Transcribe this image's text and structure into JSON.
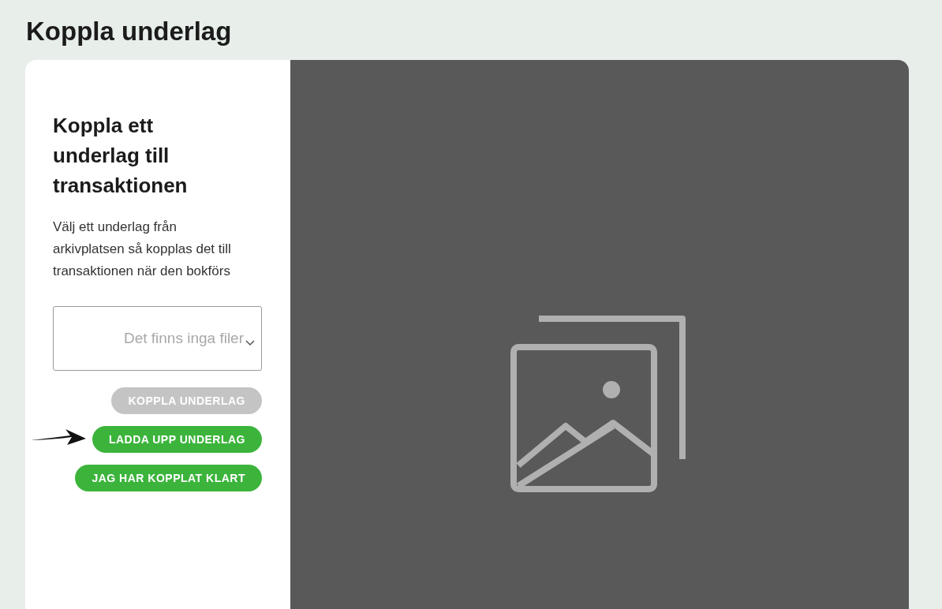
{
  "page": {
    "title": "Koppla underlag"
  },
  "panel": {
    "heading": "Koppla ett underlag till transaktionen",
    "description": "Välj ett underlag från arkivplatsen så kopplas det till transaktionen när den bokförs",
    "file_select": {
      "placeholder": "Det finns inga filer"
    },
    "buttons": [
      {
        "label": "KOPPLA UNDERLAG",
        "disabled": true,
        "pointer": false
      },
      {
        "label": "LADDA UPP UNDERLAG",
        "disabled": false,
        "pointer": true
      },
      {
        "label": "JAG HAR KOPPLAT KLART",
        "disabled": false,
        "pointer": false
      }
    ]
  },
  "preview": {
    "kind": "placeholder"
  }
}
